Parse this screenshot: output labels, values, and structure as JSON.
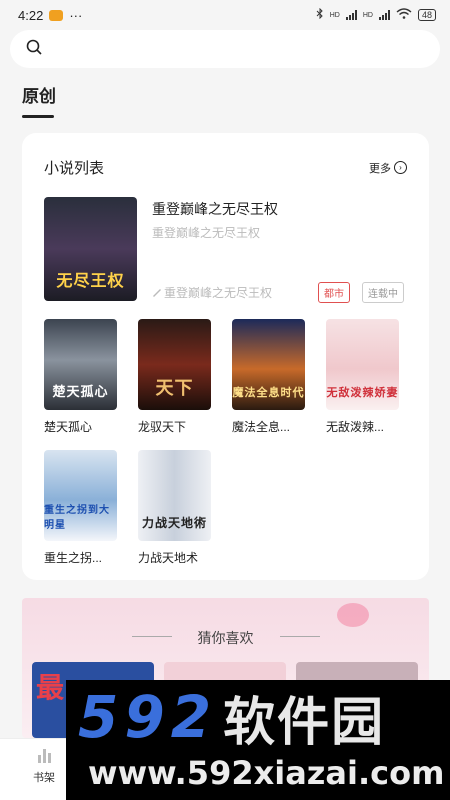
{
  "status": {
    "time": "4:22",
    "dots": "···",
    "hd1": "HD",
    "hd2": "HD",
    "battery": "48"
  },
  "search": {
    "placeholder": ""
  },
  "tab": {
    "title": "原创"
  },
  "section": {
    "title": "小说列表",
    "more_label": "更多",
    "more_icon": "chevron-right-icon"
  },
  "featured": {
    "title": "重登巅峰之无尽王权",
    "subtitle": "重登巅峰之无尽王权",
    "author": "重登巅峰之无尽王权",
    "tags": [
      "都市",
      "连载中"
    ],
    "cover_text": "无尽王权"
  },
  "books": [
    {
      "name": "楚天孤心",
      "cover_text": "楚天孤心"
    },
    {
      "name": "龙驭天下",
      "cover_text": "天下"
    },
    {
      "name": "魔法全息...",
      "cover_text": "魔法全息时代"
    },
    {
      "name": "无敌泼辣...",
      "cover_text": "无敌泼辣娇妻"
    },
    {
      "name": "重生之拐...",
      "cover_text": "重生之拐到大明星"
    },
    {
      "name": "力战天地术",
      "cover_text": "力战天地術"
    }
  ],
  "banner": {
    "title": "猜你喜欢",
    "promo": "最"
  },
  "bottom_nav": {
    "items": [
      {
        "label": "书架",
        "icon": "bar-chart-icon"
      }
    ]
  },
  "watermark": {
    "brand_num": "592",
    "brand_cn": "软件园",
    "url": "www.592xiazai.com"
  }
}
